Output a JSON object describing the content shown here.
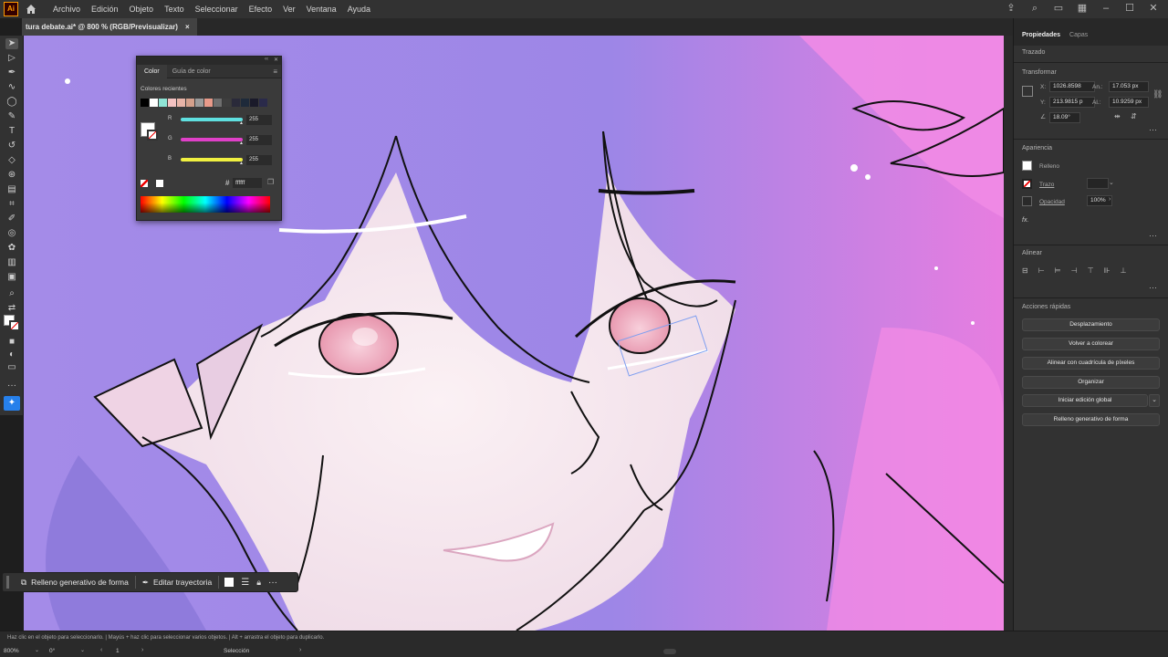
{
  "app": {
    "logo": "Ai"
  },
  "menu": [
    "Archivo",
    "Edición",
    "Objeto",
    "Texto",
    "Seleccionar",
    "Efecto",
    "Ver",
    "Ventana",
    "Ayuda"
  ],
  "document_tab": {
    "title": "tura debate.ai* @ 800 % (RGB/Previsualizar)",
    "close": "×"
  },
  "color_panel": {
    "tabs": [
      "Color",
      "Guía de color"
    ],
    "recent_label": "Colores recientes",
    "recent_swatches": [
      "#000000",
      "#ffffff",
      "#8fe3d5",
      "#f4c2c2",
      "#e8b4a8",
      "#d4a08c",
      "#9b9b9b",
      "#e89a8a",
      "#6e6e6e",
      "#3e3e3e",
      "#2a2a3a",
      "#1e2a3a",
      "#1a1a2a",
      "#2a2a4a"
    ],
    "channels": [
      {
        "name": "R",
        "value": "255",
        "color": "#5fe0e0"
      },
      {
        "name": "G",
        "value": "255",
        "color": "#e040c8"
      },
      {
        "name": "B",
        "value": "255",
        "color": "#f0f040"
      }
    ],
    "hex_label": "#",
    "hex": "ffffff"
  },
  "properties": {
    "tabs": [
      "Propiedades",
      "Capas"
    ],
    "selection_type": "Trazado",
    "transform": {
      "title": "Transformar",
      "x_label": "X:",
      "x": "1026.8598",
      "y_label": "Y:",
      "y": "213.9815 p",
      "w_label": "An.:",
      "w": "17.053 px",
      "h_label": "Al.:",
      "h": "10.9259 px",
      "angle": "18.09°"
    },
    "appearance": {
      "title": "Apariencia",
      "fill_label": "Relleno",
      "stroke_label": "Trazo",
      "opacity_label": "Opacidad",
      "opacity": "100%",
      "fx": "fx."
    },
    "align": {
      "title": "Alinear"
    },
    "quick_actions": {
      "title": "Acciones rápidas",
      "buttons": [
        "Desplazamiento",
        "Volver a colorear",
        "Alinear con cuadrícula de píxeles",
        "Organizar",
        "Iniciar edición global",
        "Relleno generativo de forma"
      ]
    }
  },
  "floating_bar": {
    "generative_fill": "Relleno generativo de forma",
    "edit_path": "Editar trayectoria"
  },
  "status": {
    "hint": "Haz clic en el objeto para seleccionarlo.  |  Mayús + haz clic para seleccionar varios objetos.  |  Alt + arrastra el objeto para duplicarlo.",
    "zoom": "800%",
    "rotation": "0°",
    "artboard": "1",
    "tool": "Selección"
  },
  "colors": {
    "accent": "#2680eb",
    "canvas_bg": "#9c87e6",
    "panel_bg": "#323232"
  }
}
